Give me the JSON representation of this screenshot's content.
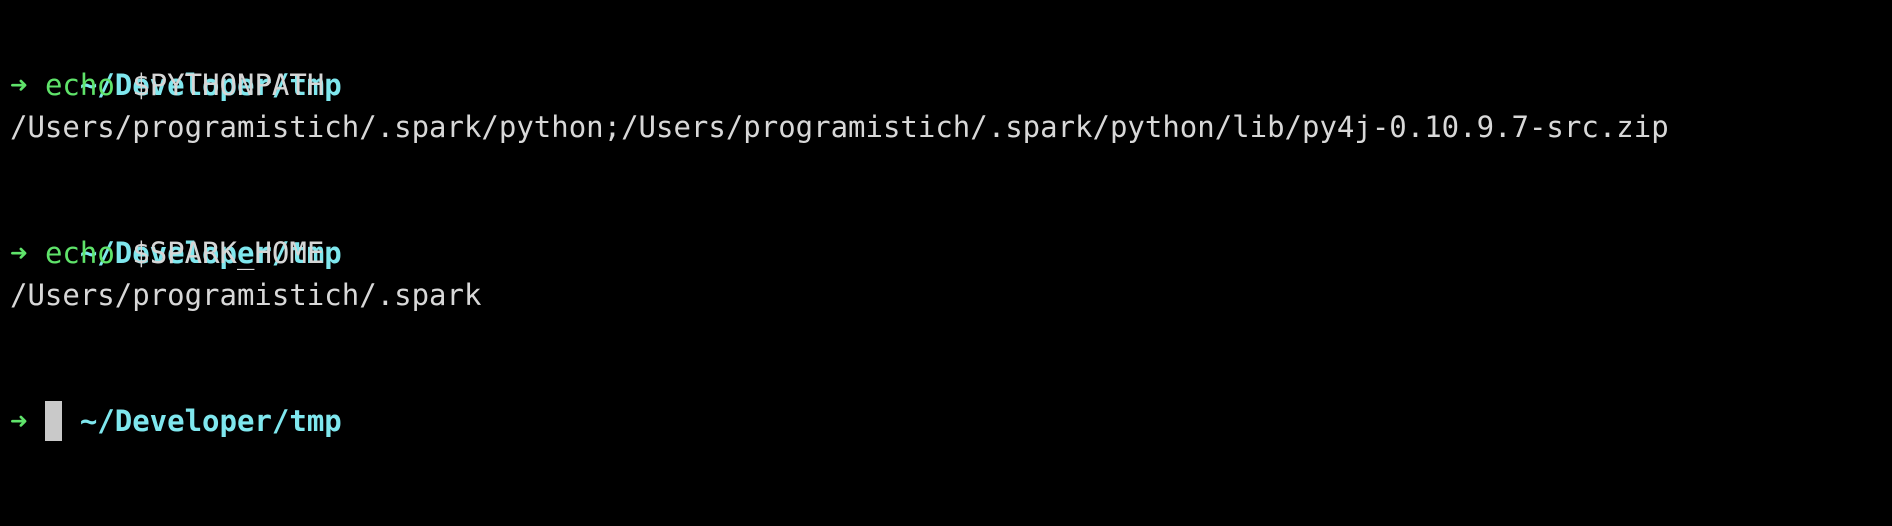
{
  "terminal": {
    "colors": {
      "background": "#000000",
      "cwd": "#7fe7ee",
      "prompt_arrow": "#5fe36a",
      "command": "#5fe36a",
      "text": "#d8d8d8",
      "cursor": "#c9c9c9"
    },
    "prompt_symbol": "➜",
    "blocks": [
      {
        "cwd": "~/Developer/tmp",
        "command": "echo",
        "argument": "$PYTHONPATH",
        "output": "/Users/programistich/.spark/python;/Users/programistich/.spark/python/lib/py4j-0.10.9.7-src.zip"
      },
      {
        "cwd": "~/Developer/tmp",
        "command": "echo",
        "argument": "$SPARK_HOME",
        "output": "/Users/programistich/.spark"
      },
      {
        "cwd": "~/Developer/tmp"
      }
    ]
  }
}
